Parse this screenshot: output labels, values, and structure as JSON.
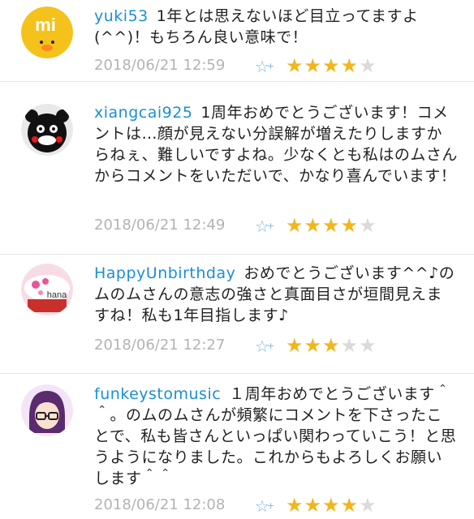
{
  "comments": [
    {
      "username": "yuki53",
      "text": "1年とは思えないほど目立ってますよ(^^)！もちろん良い意味で！",
      "timestamp": "2018/06/21 12:59",
      "rating": 4,
      "avatar_text": "mi",
      "avatar_icon": "mi-logo-icon"
    },
    {
      "username": "xiangcai925",
      "text": "1周年おめでとうございます！コメントは…顔が見えない分誤解が増えたりしますからねぇ、難しいですよね。少なくとも私はのムさんからコメントをいただいで、かなり喜んでいます！",
      "timestamp": "2018/06/21 12:49",
      "rating": 4,
      "avatar_icon": "bear-mascot-icon"
    },
    {
      "username": "HappyUnbirthday",
      "text": "おめでとうございます^^♪のムのムさんの意志の強さと真面目さが垣間見えますね！私も1年目指します♪",
      "timestamp": "2018/06/21 12:27",
      "rating": 3,
      "avatar_text": "hana",
      "avatar_icon": "cupcake-icon"
    },
    {
      "username": "funkeystomusic",
      "text": "１周年おめでとうございます＾＾。のムのムさんが頻繁にコメントを下さったことで、私も皆さんといっぱい関わっていこう！と思うようになりました。これからもよろしくお願いします＾＾",
      "timestamp": "2018/06/21 12:08",
      "rating": 4,
      "avatar_icon": "glasses-person-icon"
    }
  ],
  "max_rating": 5,
  "colors": {
    "username": "#1a8fd6",
    "timestamp": "#b3b3b3",
    "star_on": "#f2b61c",
    "star_off": "#dadada",
    "favorite": "#7bb3e6"
  }
}
